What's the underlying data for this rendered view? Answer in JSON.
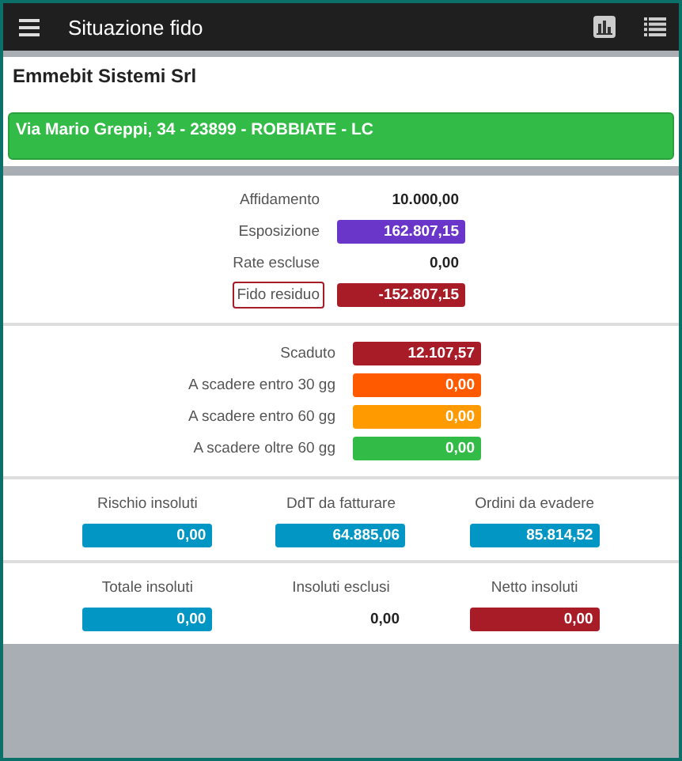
{
  "app_bar": {
    "title": "Situazione fido"
  },
  "customer": {
    "name": "Emmebit Sistemi Srl",
    "address": "Via Mario Greppi, 34 - 23899 - ROBBIATE - LC"
  },
  "credit": [
    {
      "label": "Affidamento",
      "value": "10.000,00",
      "outlined": false
    },
    {
      "label": "Esposizione",
      "value": "162.807,15",
      "color": "#6a35c9",
      "outlined": false
    },
    {
      "label": "Rate escluse",
      "value": "0,00",
      "outlined": false
    },
    {
      "label": "Fido residuo",
      "value": "-152.807,15",
      "color": "#a81c28",
      "outlined": true
    }
  ],
  "due": [
    {
      "label": "Scaduto",
      "value": "12.107,57",
      "color": "#a81c28"
    },
    {
      "label": "A scadere entro 30 gg",
      "value": "0,00",
      "color": "#ff5a00"
    },
    {
      "label": "A scadere entro 60 gg",
      "value": "0,00",
      "color": "#ff9a00"
    },
    {
      "label": "A scadere oltre 60 gg",
      "value": "0,00",
      "color": "#33bb48"
    }
  ],
  "risks": [
    {
      "label": "Rischio insoluti",
      "value": "0,00",
      "color": "#0196c4"
    },
    {
      "label": "DdT da fatturare",
      "value": "64.885,06",
      "color": "#0196c4"
    },
    {
      "label": "Ordini da evadere",
      "value": "85.814,52",
      "color": "#0196c4"
    }
  ],
  "unpaid": [
    {
      "label": "Totale insoluti",
      "value": "0,00",
      "color": "#0196c4"
    },
    {
      "label": "Insoluti esclusi",
      "value": "0,00"
    },
    {
      "label": "Netto insoluti",
      "value": "0,00",
      "color": "#a81c28"
    }
  ]
}
